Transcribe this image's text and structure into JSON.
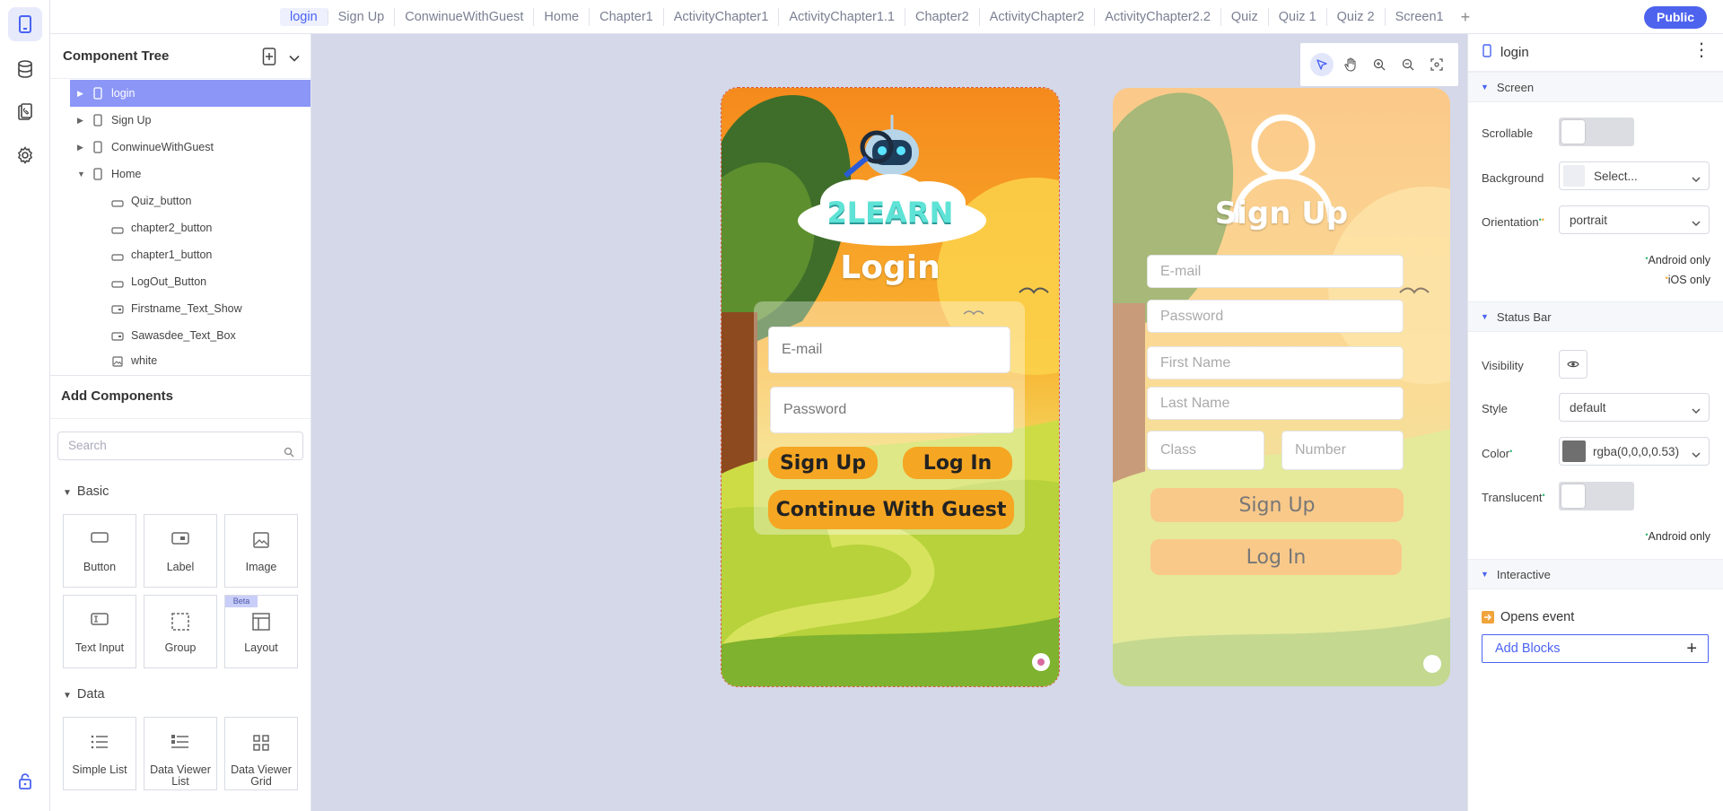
{
  "topbar": {
    "tabs": [
      "login",
      "Sign Up",
      "ConwinueWithGuest",
      "Home",
      "Chapter1",
      "ActivityChapter1",
      "ActivityChapter1.1",
      "Chapter2",
      "ActivityChapter2",
      "ActivityChapter2.2",
      "Quiz",
      "Quiz 1",
      "Quiz 2",
      "Screen1"
    ],
    "active_tab": "login",
    "add_tab": "+",
    "public_label": "Public"
  },
  "component_tree": {
    "title": "Component Tree",
    "items": [
      {
        "label": "login",
        "level": 0,
        "type": "screen",
        "selected": true
      },
      {
        "label": "Sign Up",
        "level": 0,
        "type": "screen"
      },
      {
        "label": "ConwinueWithGuest",
        "level": 0,
        "type": "screen"
      },
      {
        "label": "Home",
        "level": 0,
        "type": "screen",
        "expanded": true
      },
      {
        "label": "Quiz_button",
        "level": 1,
        "type": "button"
      },
      {
        "label": "chapter2_button",
        "level": 1,
        "type": "button"
      },
      {
        "label": "chapter1_button",
        "level": 1,
        "type": "button"
      },
      {
        "label": "LogOut_Button",
        "level": 1,
        "type": "button"
      },
      {
        "label": "Firstname_Text_Show",
        "level": 1,
        "type": "label"
      },
      {
        "label": "Sawasdee_Text_Box",
        "level": 1,
        "type": "label"
      },
      {
        "label": "white",
        "level": 1,
        "type": "image"
      }
    ]
  },
  "add_components": {
    "title": "Add Components",
    "search_placeholder": "Search",
    "basic": {
      "label": "Basic",
      "items": [
        "Button",
        "Label",
        "Image",
        "Text Input",
        "Group",
        "Layout"
      ],
      "beta_badge": "Beta"
    },
    "data": {
      "label": "Data",
      "items": [
        "Simple List",
        "Data Viewer List",
        "Data Viewer Grid"
      ]
    }
  },
  "canvas": {
    "login_screen": {
      "logo_text": "2LEARN",
      "title": "Login",
      "email_placeholder": "E-mail",
      "password_placeholder": "Password",
      "signup_button": "Sign Up",
      "login_button": "Log In",
      "guest_button": "Continue With Guest"
    },
    "signup_screen": {
      "title": "Sign Up",
      "email_placeholder": "E-mail",
      "password_placeholder": "Password",
      "firstname_placeholder": "First Name",
      "lastname_placeholder": "Last Name",
      "class_placeholder": "Class",
      "number_placeholder": "Number",
      "signup_button": "Sign Up",
      "login_button": "Log In"
    }
  },
  "properties": {
    "component_name": "login",
    "screen": {
      "label": "Screen",
      "scrollable_label": "Scrollable",
      "scrollable": false,
      "background_label": "Background",
      "background_value": "Select...",
      "orientation_label": "Orientation",
      "orientation_value": "portrait",
      "note_android": "Android only",
      "note_ios": "iOS only"
    },
    "status_bar": {
      "label": "Status Bar",
      "visibility_label": "Visibility",
      "style_label": "Style",
      "style_value": "default",
      "color_label": "Color",
      "color_value": "rgba(0,0,0,0.53)",
      "translucent_label": "Translucent",
      "translucent": false,
      "note_android": "Android only"
    },
    "interactive": {
      "label": "Interactive",
      "event_label": "Opens event",
      "add_blocks_label": "Add Blocks"
    }
  },
  "colors": {
    "accent": "#4a63f3",
    "selection": "#8b96f6",
    "button_orange": "#f5a623",
    "android_dot": "#2bb673",
    "ios_dot": "#f5a623"
  }
}
